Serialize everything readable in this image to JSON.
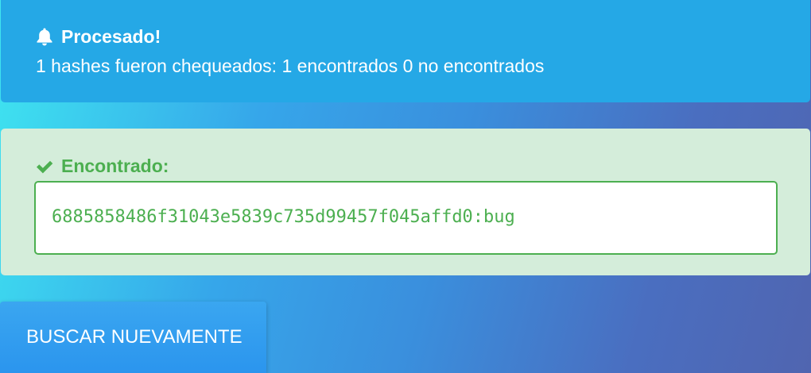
{
  "info_alert": {
    "title": "Procesado!",
    "message": "1 hashes fueron chequeados: 1 encontrados 0 no encontrados",
    "icon": "bell-icon",
    "color": "#25a8e6"
  },
  "success_alert": {
    "title": "Encontrado:",
    "icon": "check-icon",
    "result": "6885858486f31043e5839c735d99457f045affd0:bug",
    "color": "#4caf50",
    "background": "#d4edda"
  },
  "actions": {
    "search_again_label": "BUSCAR NUEVAMENTE"
  }
}
